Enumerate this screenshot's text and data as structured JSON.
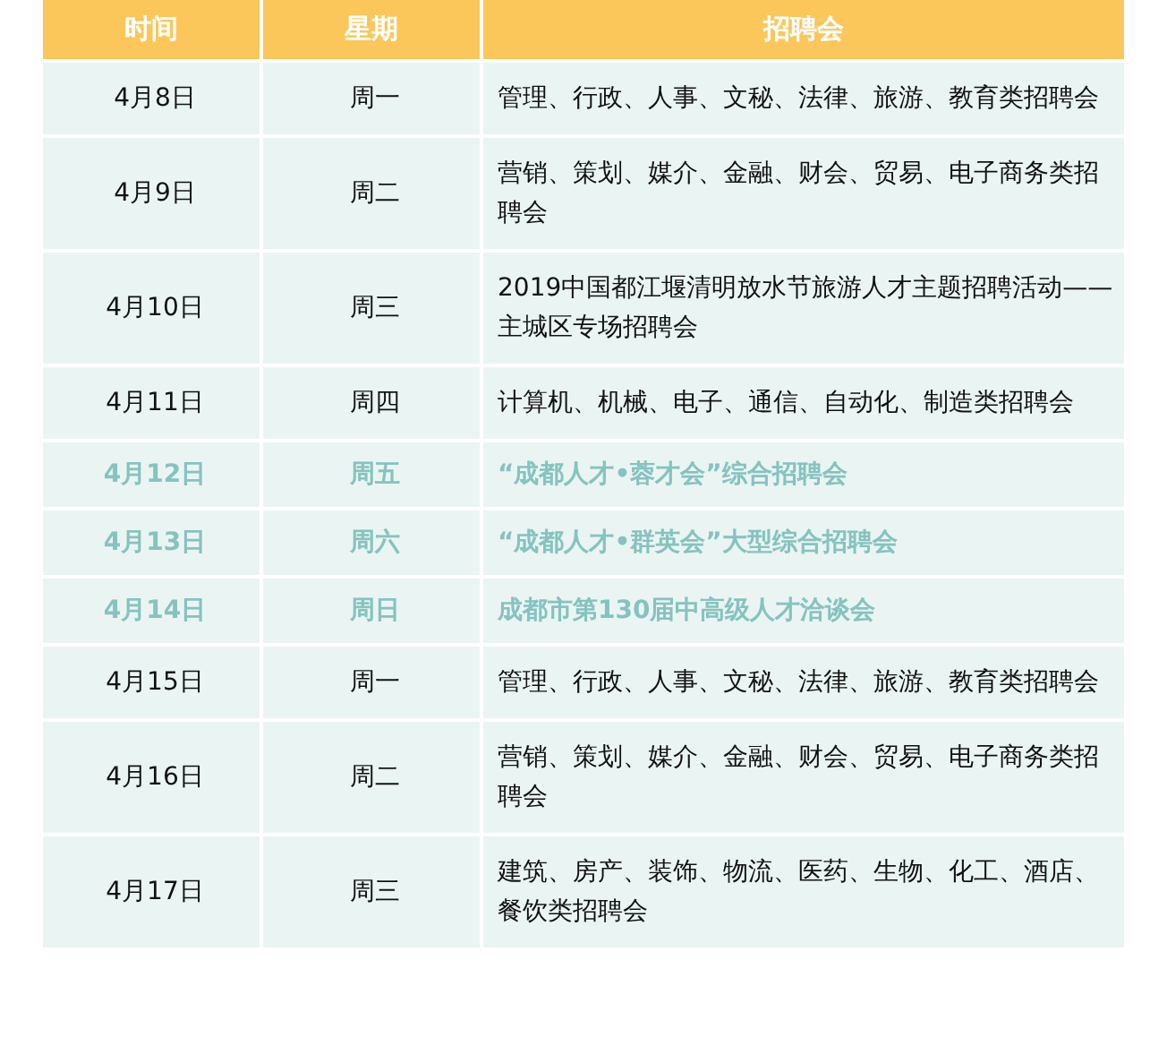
{
  "table": {
    "columns": [
      "时间",
      "星期",
      "招聘会"
    ],
    "rows": [
      {
        "date": "4月8日",
        "weekday": "周一",
        "fair": "管理、行政、人事、文秘、法律、旅游、教育类招聘会",
        "highlighted": false
      },
      {
        "date": "4月9日",
        "weekday": "周二",
        "fair": "营销、策划、媒介、金融、财会、贸易、电子商务类招聘会",
        "highlighted": false
      },
      {
        "date": "4月10日",
        "weekday": "周三",
        "fair": "2019中国都江堰清明放水节旅游人才主题招聘活动——主城区专场招聘会",
        "highlighted": false
      },
      {
        "date": "4月11日",
        "weekday": "周四",
        "fair": "计算机、机械、电子、通信、自动化、制造类招聘会",
        "highlighted": false
      },
      {
        "date": "4月12日",
        "weekday": "周五",
        "fair": "“成都人才•蓉才会”综合招聘会",
        "highlighted": true
      },
      {
        "date": "4月13日",
        "weekday": "周六",
        "fair": "“成都人才•群英会”大型综合招聘会",
        "highlighted": true
      },
      {
        "date": "4月14日",
        "weekday": "周日",
        "fair": "成都市第130届中高级人才洽谈会",
        "highlighted": true
      },
      {
        "date": "4月15日",
        "weekday": "周一",
        "fair": "管理、行政、人事、文秘、法律、旅游、教育类招聘会",
        "highlighted": false
      },
      {
        "date": "4月16日",
        "weekday": "周二",
        "fair": "营销、策划、媒介、金融、财会、贸易、电子商务类招聘会",
        "highlighted": false
      },
      {
        "date": "4月17日",
        "weekday": "周三",
        "fair": "建筑、房产、装饰、物流、医药、生物、化工、酒店、餐饮类招聘会",
        "highlighted": false
      }
    ]
  }
}
